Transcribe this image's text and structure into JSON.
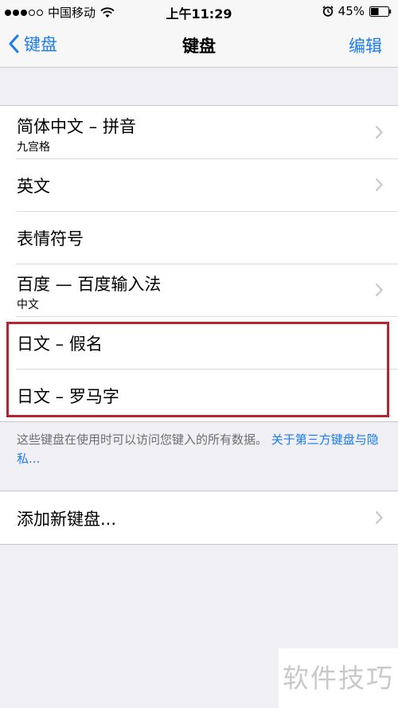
{
  "status_bar": {
    "carrier": "中国移动",
    "time": "上午11:29",
    "battery": "45%",
    "signal_dots_filled": 3,
    "signal_dots_total": 5,
    "battery_level": 0.45
  },
  "nav": {
    "back_label": "键盘",
    "title": "键盘",
    "edit_label": "编辑"
  },
  "keyboards": [
    {
      "label": "简体中文 – 拼音",
      "sub": "九宫格",
      "chevron": true
    },
    {
      "label": "英文",
      "sub": "",
      "chevron": true
    },
    {
      "label": "表情符号",
      "sub": "",
      "chevron": false
    },
    {
      "label": "百度 — 百度输入法",
      "sub": "中文",
      "chevron": true
    },
    {
      "label": "日文 – 假名",
      "sub": "",
      "chevron": false
    },
    {
      "label": "日文 – 罗马字",
      "sub": "",
      "chevron": false
    }
  ],
  "footer": {
    "text": "这些键盘在使用时可以访问您键入的所有数据。",
    "link": "关于第三方键盘与隐私..."
  },
  "add": {
    "label": "添加新键盘..."
  },
  "watermark": "软件技巧",
  "colors": {
    "accent": "#1a7cf5",
    "highlight": "#b5252f",
    "background": "#efeff4"
  }
}
